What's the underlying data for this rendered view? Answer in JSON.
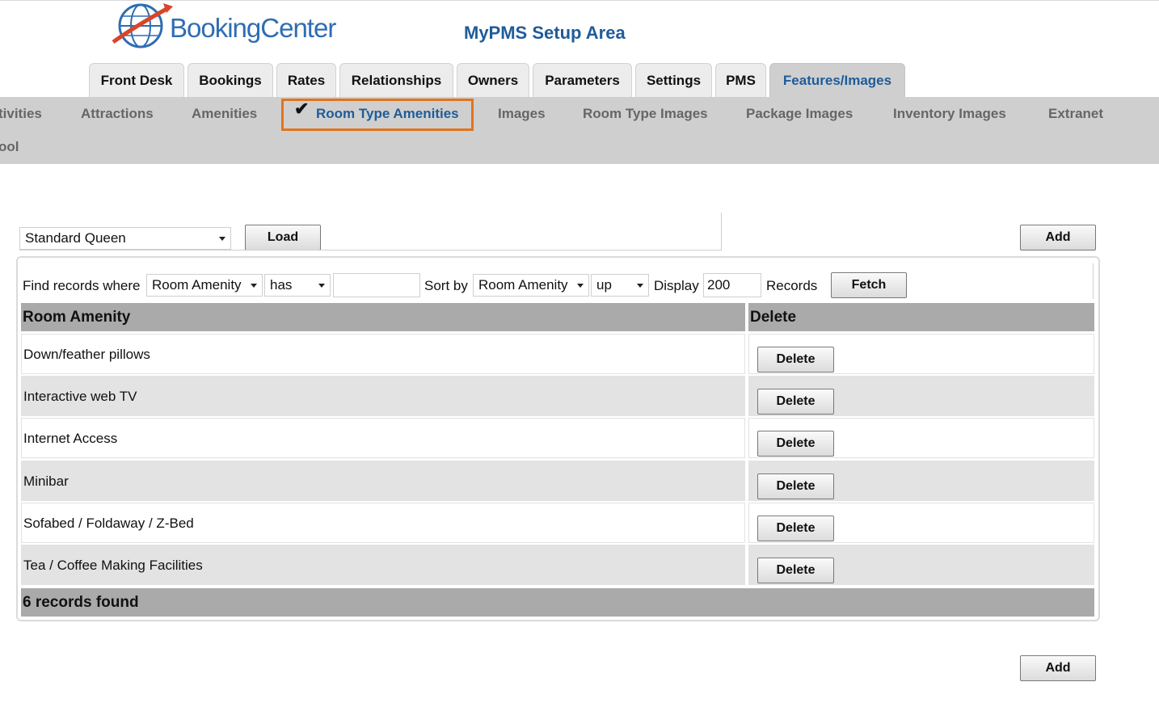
{
  "header": {
    "logo_text": "BookingCenter",
    "app_title": "MyPMS Setup Area"
  },
  "main_tabs": [
    {
      "label": "Front Desk"
    },
    {
      "label": "Bookings"
    },
    {
      "label": "Rates"
    },
    {
      "label": "Relationships"
    },
    {
      "label": "Owners"
    },
    {
      "label": "Parameters"
    },
    {
      "label": "Settings"
    },
    {
      "label": "PMS"
    },
    {
      "label": "Features/Images",
      "active": true
    }
  ],
  "sub_nav": [
    {
      "label": "tivities"
    },
    {
      "label": "Attractions"
    },
    {
      "label": "Amenities"
    },
    {
      "label": "Room Type Amenities",
      "active": true
    },
    {
      "label": "Images"
    },
    {
      "label": "Room Type Images"
    },
    {
      "label": "Package Images"
    },
    {
      "label": "Inventory Images"
    },
    {
      "label": "Extranet"
    },
    {
      "label": "ool"
    }
  ],
  "room_type_select": {
    "value": "Standard Queen"
  },
  "load_button": "Load",
  "add_button": "Add",
  "filter": {
    "find_label": "Find records where",
    "field_select": "Room Amenity",
    "operator_select": "has",
    "value": "",
    "sort_label": "Sort by",
    "sort_select": "Room Amenity",
    "direction_select": "up",
    "display_label": "Display",
    "display_value": "200",
    "records_label": "Records",
    "fetch_button": "Fetch"
  },
  "table": {
    "columns": [
      "Room Amenity",
      "Delete"
    ],
    "delete_label": "Delete",
    "rows": [
      {
        "amenity": "Down/feather pillows"
      },
      {
        "amenity": "Interactive web TV"
      },
      {
        "amenity": "Internet Access"
      },
      {
        "amenity": "Minibar"
      },
      {
        "amenity": "Sofabed / Foldaway / Z-Bed"
      },
      {
        "amenity": "Tea / Coffee Making Facilities"
      }
    ],
    "footer": "6 records found"
  },
  "colors": {
    "accent": "#1f5c99",
    "highlight_border": "#e2741d",
    "subnav_bg": "#cfcfcf",
    "header_bg": "#aaaaaa"
  }
}
